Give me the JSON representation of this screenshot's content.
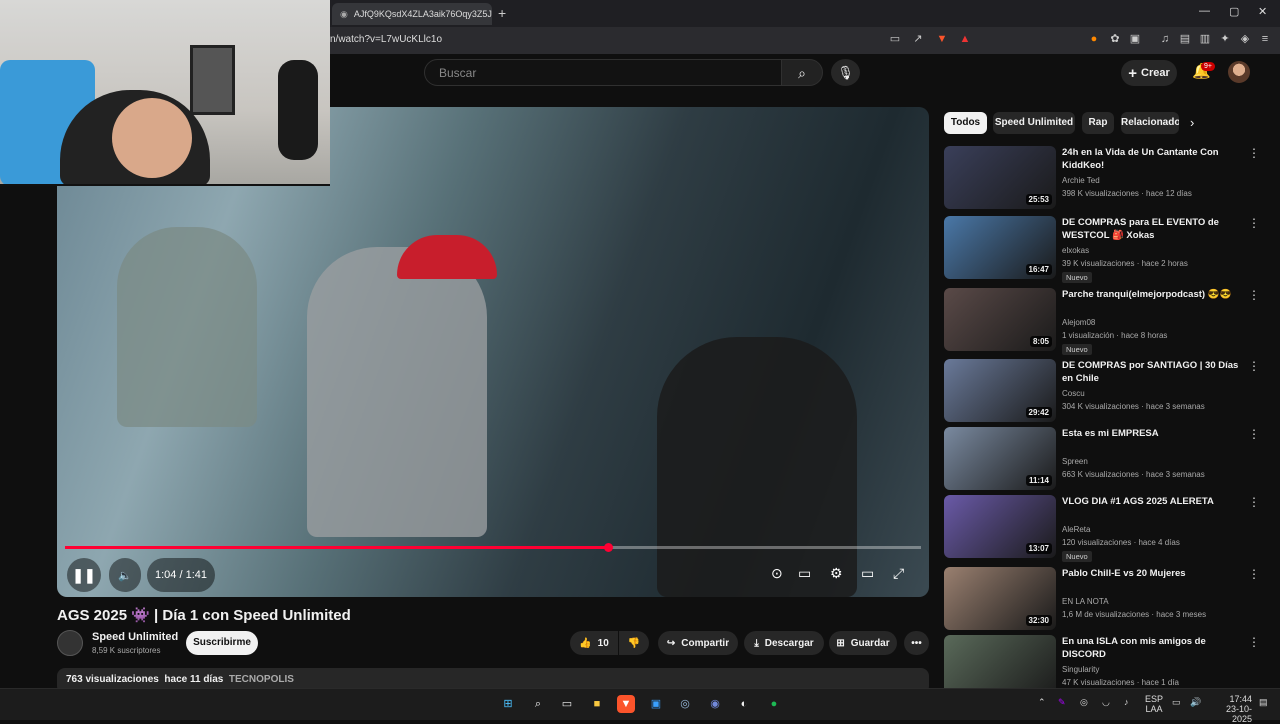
{
  "browser": {
    "tab_title": "AJfQ9KQsdX4ZLA3aik76Oqy3Z5JUZe",
    "url": "n/watch?v=L7wUcKLlc1o",
    "new_tab": "+",
    "minimize": "—",
    "maximize": "▢",
    "close": "✕"
  },
  "header": {
    "search_placeholder": "Buscar",
    "create_label": "Crear",
    "notifications_badge": "9+"
  },
  "player": {
    "time": "1:04 / 1:41",
    "progress_fraction": 0.634
  },
  "video": {
    "title": "AGS 2025 👾 | Día 1 con Speed Unlimited",
    "channel": "Speed Unlimited",
    "subscribers": "8,59 K suscriptores",
    "subscribe_label": "Suscribirme",
    "likes": "10",
    "share_label": "Compartir",
    "download_label": "Descargar",
    "save_label": "Guardar",
    "more_label": "•••",
    "views": "763 visualizaciones",
    "date": "hace 11 días",
    "tag": "TECNOPOLIS"
  },
  "chips": [
    "Todos",
    "Speed Unlimited",
    "Rap",
    "Relacionado"
  ],
  "sidebar": [
    {
      "title": "24h en la Vida de Un Cantante Con KiddKeo!",
      "channel": "Archie Ted",
      "meta": "398 K visualizaciones · hace 12 días",
      "duration": "25:53",
      "new": "",
      "color": "#3a3f5a"
    },
    {
      "title": "DE COMPRAS para EL EVENTO de WESTCOL 🎒 Xokas",
      "channel": "elxokas",
      "meta": "39 K visualizaciones · hace 2 horas",
      "duration": "16:47",
      "new": "Nuevo",
      "color": "#4a78a8"
    },
    {
      "title": "Parche tranqui(elmejorpodcast) 😎😎",
      "channel": "Alejom08",
      "meta": "1 visualización · hace 8 horas",
      "duration": "8:05",
      "new": "Nuevo",
      "color": "#5a4a48"
    },
    {
      "title": "DE COMPRAS por SANTIAGO | 30 Días en Chile",
      "channel": "Coscu",
      "meta": "304 K visualizaciones · hace 3 semanas",
      "duration": "29:42",
      "new": "",
      "color": "#6a7a9a"
    },
    {
      "title": "Esta es mi EMPRESA",
      "channel": "Spreen",
      "meta": "663 K visualizaciones · hace 3 semanas",
      "duration": "11:14",
      "new": "",
      "color": "#7a8aa0"
    },
    {
      "title": "VLOG DIA #1 AGS 2025 ALERETA",
      "channel": "AleReta",
      "meta": "120 visualizaciones · hace 4 días",
      "duration": "13:07",
      "new": "Nuevo",
      "color": "#6a5aa8"
    },
    {
      "title": "Pablo Chill-E vs 20 Mujeres",
      "channel": "EN LA NOTA",
      "meta": "1,6 M de visualizaciones · hace 3 meses",
      "duration": "32:30",
      "new": "",
      "color": "#9a8070"
    },
    {
      "title": "En una ISLA con mis amigos de DISCORD",
      "channel": "Singularity",
      "meta": "47 K visualizaciones · hace 1 día",
      "duration": "",
      "new": "",
      "color": "#5a6a5a"
    }
  ],
  "taskbar": {
    "lang_top": "ESP",
    "lang_bottom": "LAA",
    "time": "17:44",
    "date": "23-10-2025"
  },
  "icons": [
    "search-icon",
    "mic-icon",
    "bell-icon",
    "play-pause-icon",
    "volume-icon",
    "settings-icon",
    "subtitles-icon",
    "fullscreen-icon",
    "like-icon",
    "dislike-icon",
    "share-icon",
    "download-icon",
    "save-icon"
  ]
}
